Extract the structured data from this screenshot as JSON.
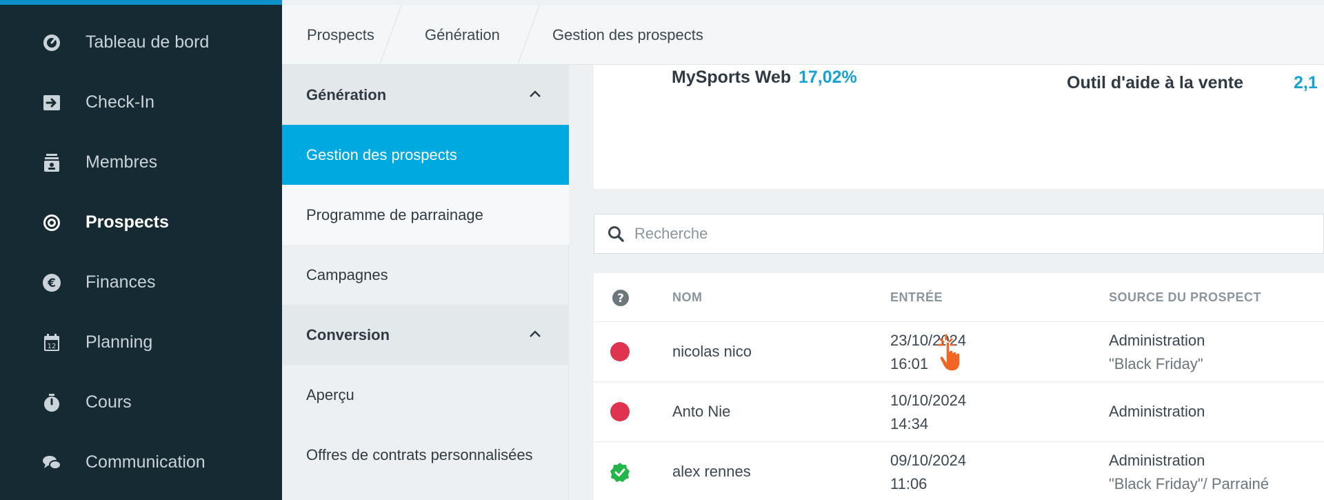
{
  "sidebar": {
    "items": [
      {
        "label": "Tableau de bord",
        "icon": "dashboard-icon"
      },
      {
        "label": "Check-In",
        "icon": "check-in-icon"
      },
      {
        "label": "Membres",
        "icon": "members-icon"
      },
      {
        "label": "Prospects",
        "icon": "prospects-icon"
      },
      {
        "label": "Finances",
        "icon": "euro-icon"
      },
      {
        "label": "Planning",
        "icon": "calendar-icon"
      },
      {
        "label": "Cours",
        "icon": "stopwatch-icon"
      },
      {
        "label": "Communication",
        "icon": "chat-icon"
      }
    ],
    "calendar_day": "12"
  },
  "breadcrumb": [
    "Prospects",
    "Génération",
    "Gestion des prospects"
  ],
  "submenu": {
    "items": [
      {
        "label": "Génération"
      },
      {
        "label": "Gestion des prospects"
      },
      {
        "label": "Programme de parrainage"
      },
      {
        "label": "Campagnes"
      },
      {
        "label": "Conversion"
      },
      {
        "label": "Aperçu"
      },
      {
        "label": "Offres de contrats personnalisées"
      }
    ]
  },
  "stats": {
    "label1": "MySports Web",
    "value1": "17,02%",
    "label2": "Outil d'aide à la vente",
    "value2": "2,1"
  },
  "search": {
    "placeholder": "Recherche"
  },
  "table": {
    "headers": {
      "name": "NOM",
      "entry": "ENTRÉE",
      "source": "SOURCE DU PROSPECT"
    },
    "rows": [
      {
        "status": "red",
        "name": "nicolas nico",
        "date": "23/10/2024",
        "time": "16:01",
        "source": "Administration",
        "source_detail": "\"Black Friday\""
      },
      {
        "status": "red",
        "name": "Anto Nie",
        "date": "10/10/2024",
        "time": "14:34",
        "source": "Administration",
        "source_detail": ""
      },
      {
        "status": "green",
        "name": "alex rennes",
        "date": "09/10/2024",
        "time": "11:06",
        "source": "Administration",
        "source_detail": "\"Black Friday\"/ Parrainé"
      }
    ]
  },
  "colors": {
    "accent": "#00a9e0",
    "sidebar": "#162a34",
    "status_red": "#e0334f",
    "status_green": "#22b548",
    "value": "#15a2d4"
  }
}
